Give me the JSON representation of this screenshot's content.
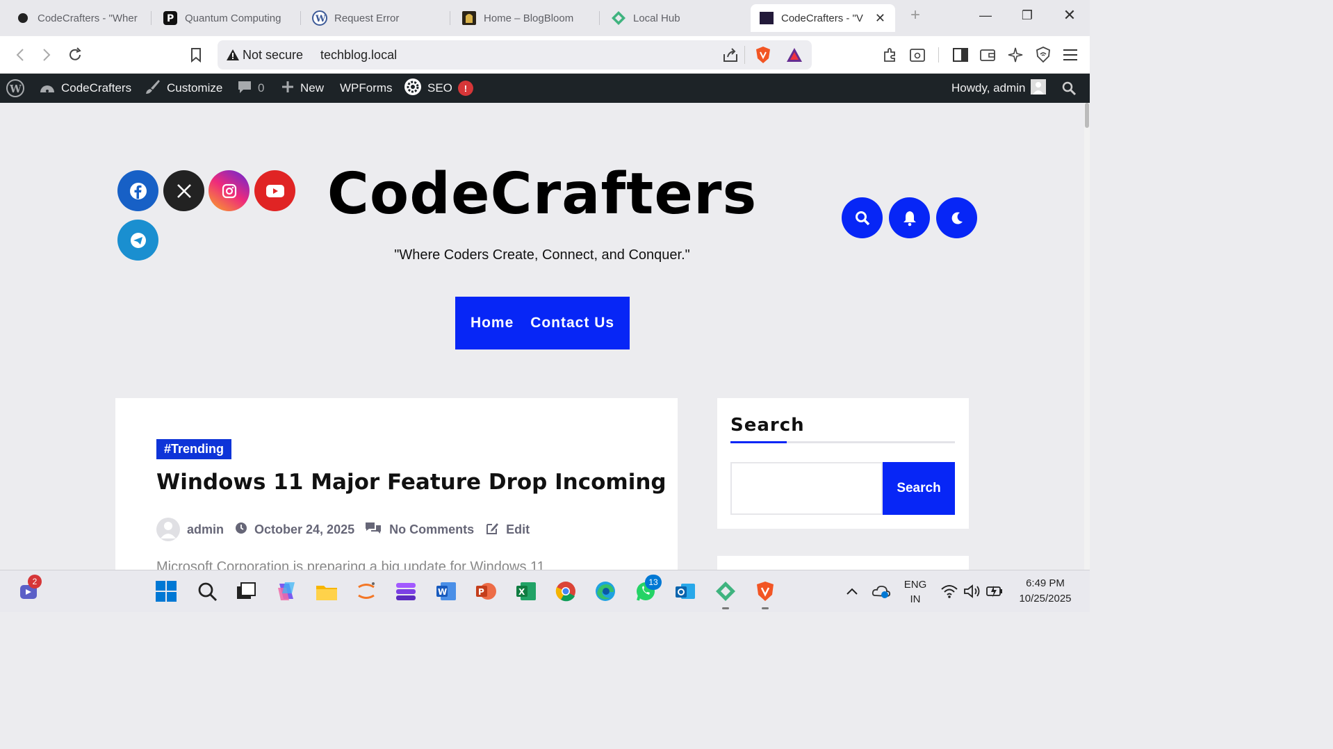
{
  "browser": {
    "tabs": [
      {
        "label": "CodeCrafters - \"Wher",
        "icon": "codecrafters-favicon"
      },
      {
        "label": "Quantum Computing",
        "icon": "p-favicon"
      },
      {
        "label": "Request Error",
        "icon": "wordpress-favicon"
      },
      {
        "label": "Home – BlogBloom",
        "icon": "blogbloom-favicon"
      },
      {
        "label": "Local Hub",
        "icon": "local-favicon"
      },
      {
        "label": "CodeCrafters - \"V",
        "icon": "codecrafters-favicon"
      }
    ],
    "security_label": "Not secure",
    "url": "techblog.local"
  },
  "wpadmin": {
    "site_name": "CodeCrafters",
    "customize": "Customize",
    "comments_count": "0",
    "new_label": "New",
    "wpforms": "WPForms",
    "seo": "SEO",
    "seo_badge": "!",
    "howdy": "Howdy, admin"
  },
  "site": {
    "title": "CodeCrafters",
    "tagline": "\"Where Coders Create, Connect, and Conquer.\"",
    "menu": [
      "Home",
      "Contact Us"
    ]
  },
  "post": {
    "category": "#Trending",
    "title": "Windows 11 Major Feature Drop Incoming",
    "author": "admin",
    "date": "October 24, 2025",
    "comments": "No Comments",
    "edit": "Edit",
    "excerpt": "Microsoft Corporation is preparing a big update for Windows 11"
  },
  "sidebar": {
    "search_title": "Search",
    "search_button": "Search"
  },
  "taskbar": {
    "teams_badge": "2",
    "whatsapp_badge": "13",
    "lang_top": "ENG",
    "lang_bottom": "IN",
    "time": "6:49 PM",
    "date": "10/25/2025"
  },
  "colors": {
    "accent": "#0726f6",
    "admin_bar": "#1d2327",
    "facebook": "#1760c6",
    "x": "#222222",
    "youtube": "#e02424",
    "telegram": "#1a8fd0"
  }
}
